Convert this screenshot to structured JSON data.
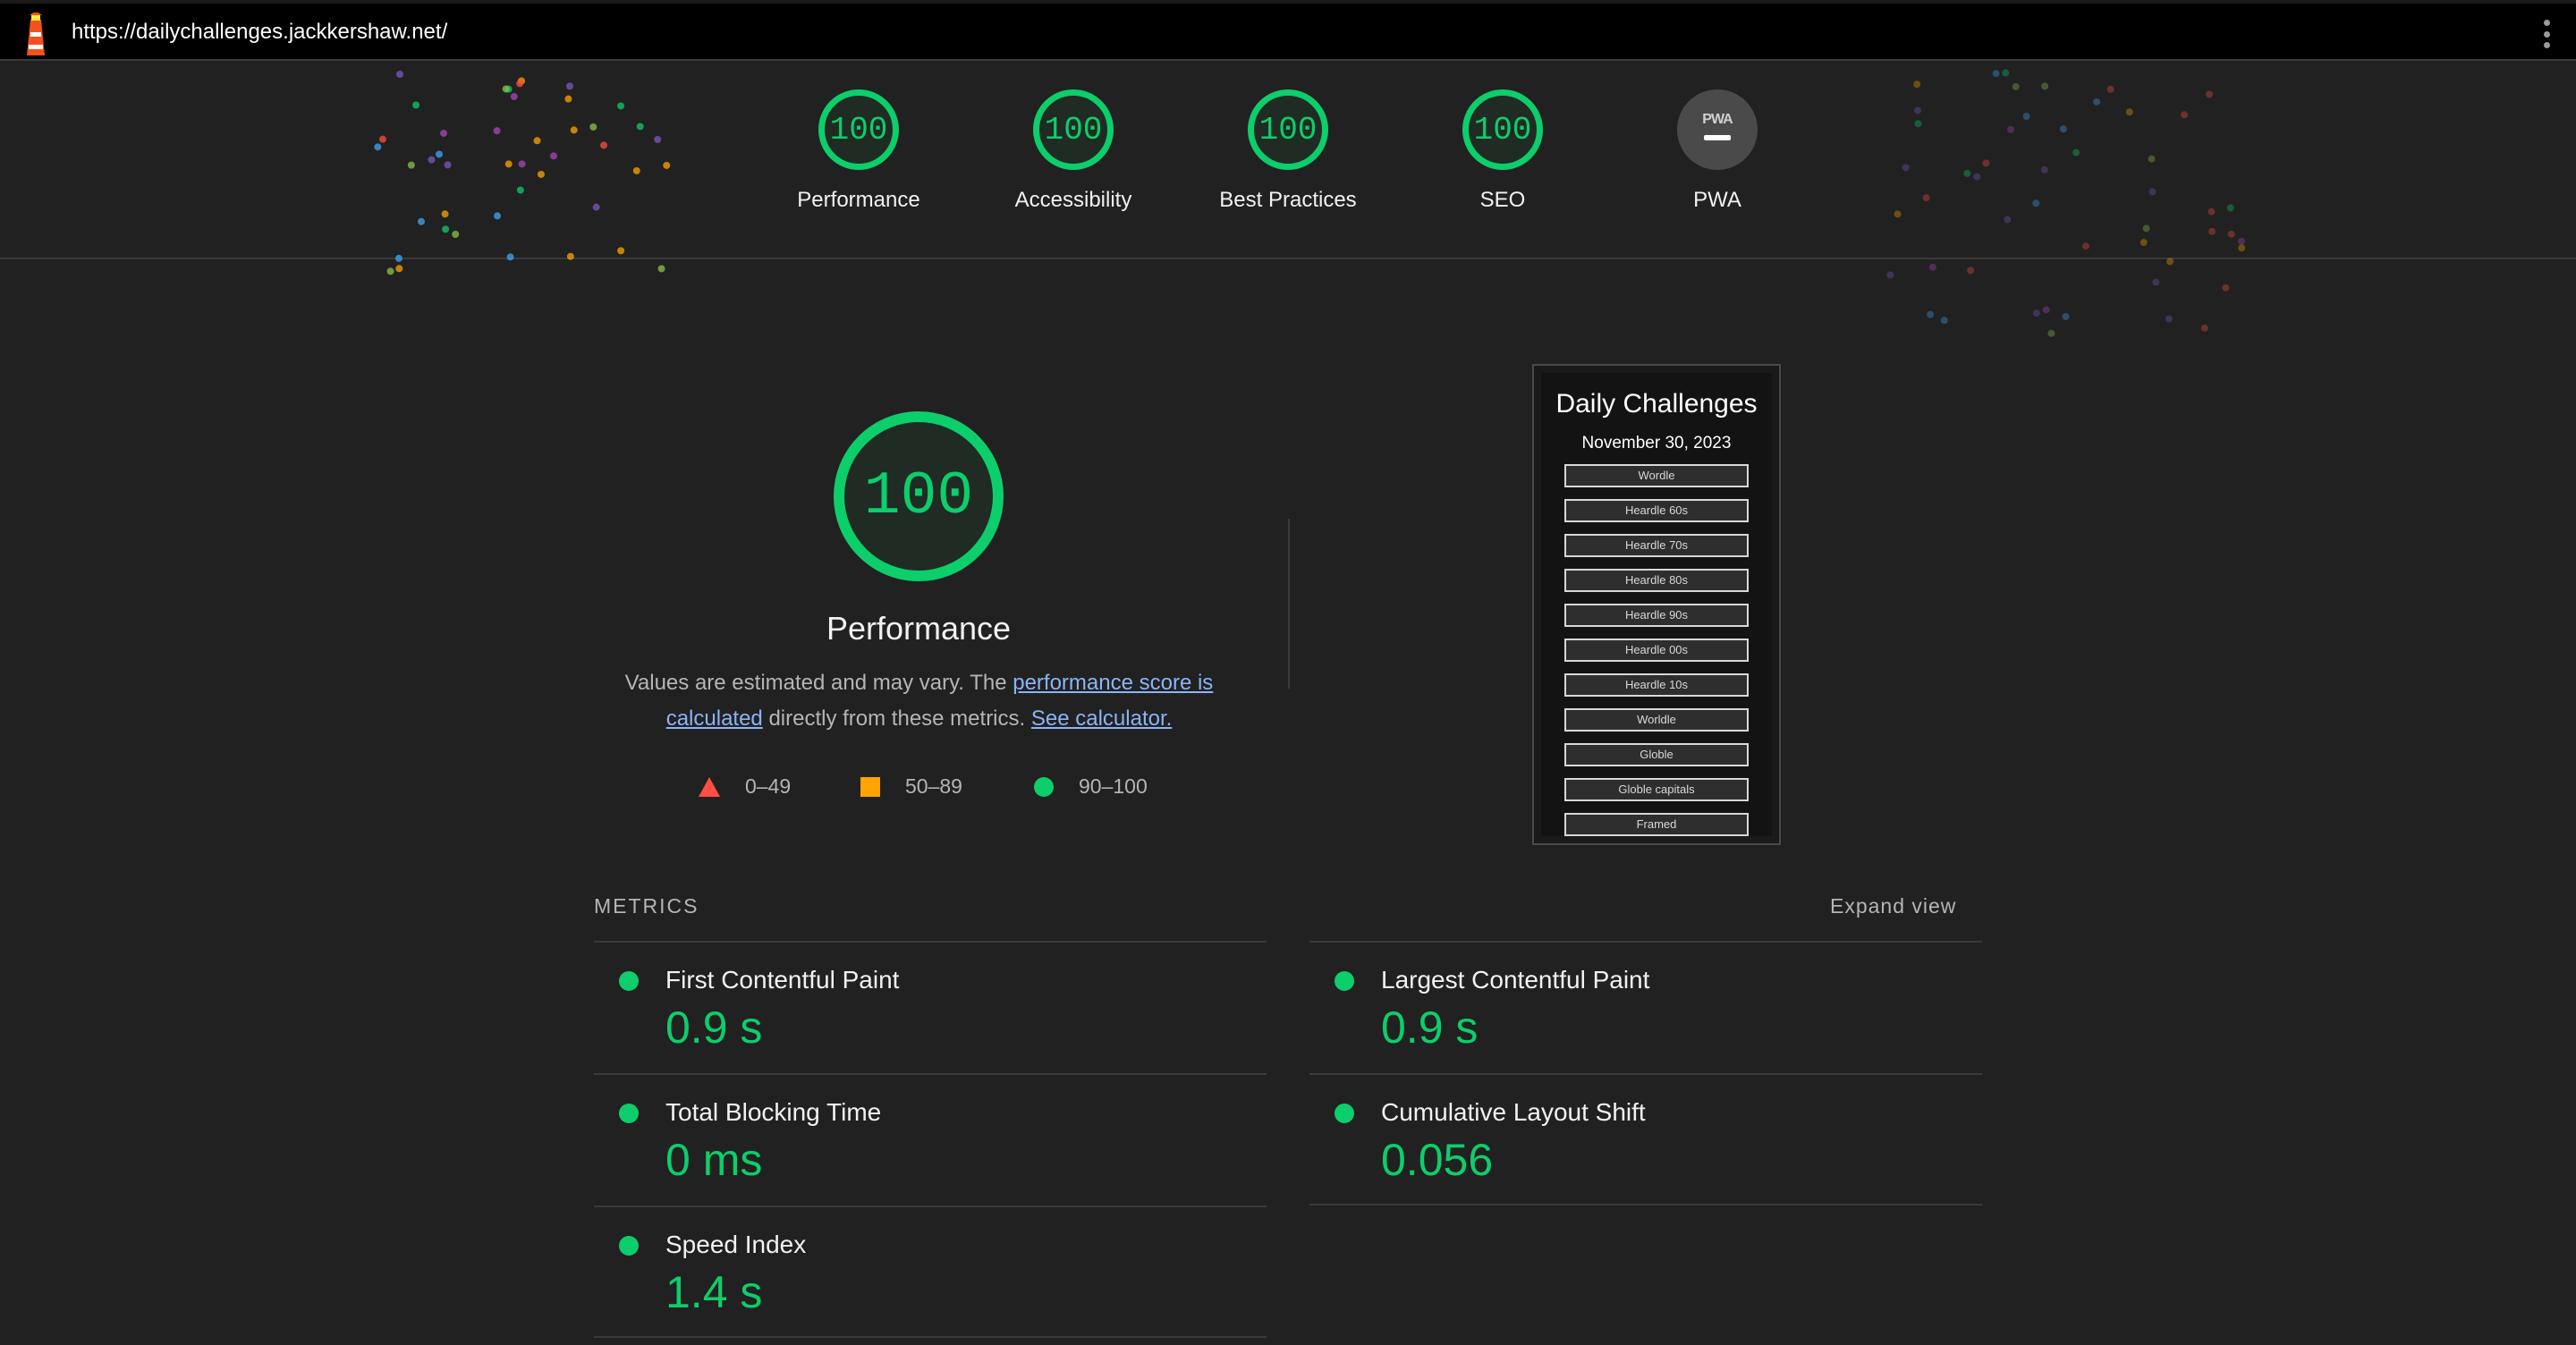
{
  "topbar": {
    "url": "https://dailychallenges.jackkershaw.net/"
  },
  "header": {
    "gauges": [
      {
        "label": "Performance",
        "score": "100"
      },
      {
        "label": "Accessibility",
        "score": "100"
      },
      {
        "label": "Best Practices",
        "score": "100"
      },
      {
        "label": "SEO",
        "score": "100"
      },
      {
        "label": "PWA",
        "badge": "PWA"
      }
    ]
  },
  "main": {
    "score": "100",
    "title": "Performance",
    "desc_prefix": "Values are estimated and may vary. The ",
    "desc_link1": "performance score is calculated",
    "desc_middle": " directly from these metrics. ",
    "desc_link2": "See calculator.",
    "legend": {
      "bad": "0–49",
      "average": "50–89",
      "pass": "90–100"
    },
    "colors": {
      "pass": "#0cce6b",
      "average": "#ffa400",
      "fail": "#ff4e42"
    }
  },
  "thumbnail": {
    "title": "Daily Challenges",
    "date": "November 30, 2023",
    "buttons": [
      "Wordle",
      "Heardle 60s",
      "Heardle 70s",
      "Heardle 80s",
      "Heardle 90s",
      "Heardle 00s",
      "Heardle 10s",
      "Worldle",
      "Globle",
      "Globle capitals",
      "Framed"
    ]
  },
  "metrics": {
    "heading": "METRICS",
    "expand_label": "Expand view",
    "items": [
      {
        "name": "First Contentful Paint",
        "value": "0.9 s"
      },
      {
        "name": "Largest Contentful Paint",
        "value": "0.9 s"
      },
      {
        "name": "Total Blocking Time",
        "value": "0 ms"
      },
      {
        "name": "Cumulative Layout Shift",
        "value": "0.056"
      },
      {
        "name": "Speed Index",
        "value": "1.4 s"
      }
    ]
  }
}
